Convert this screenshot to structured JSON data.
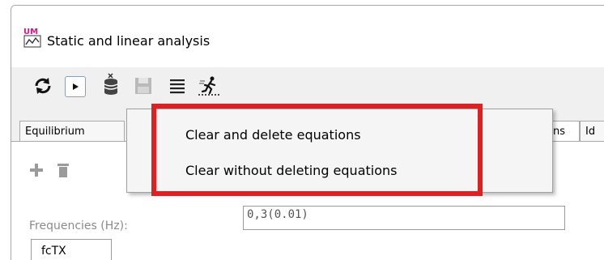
{
  "window": {
    "title": "Static and linear analysis",
    "app_icon": "um-chart-icon"
  },
  "toolbar": {
    "buttons": [
      {
        "icon": "refresh-icon"
      },
      {
        "icon": "play-icon"
      },
      {
        "icon": "clear-database-icon"
      },
      {
        "icon": "save-icon"
      },
      {
        "icon": "list-icon"
      },
      {
        "icon": "run-icon"
      }
    ]
  },
  "tabs": {
    "items": [
      {
        "label": "Equilibrium"
      },
      {
        "label": "ons"
      },
      {
        "label": "Id"
      }
    ]
  },
  "panel": {
    "add_icon": "plus-icon",
    "delete_icon": "trash-icon",
    "frequencies_label": "Frequencies (Hz):",
    "frequencies_value": "0,3(0.01)",
    "fctx_label": "fcTX"
  },
  "context_menu": {
    "items": [
      {
        "label": "Clear and delete equations"
      },
      {
        "label": "Clear without deleting equations"
      }
    ]
  },
  "highlight_color": "#e02020"
}
